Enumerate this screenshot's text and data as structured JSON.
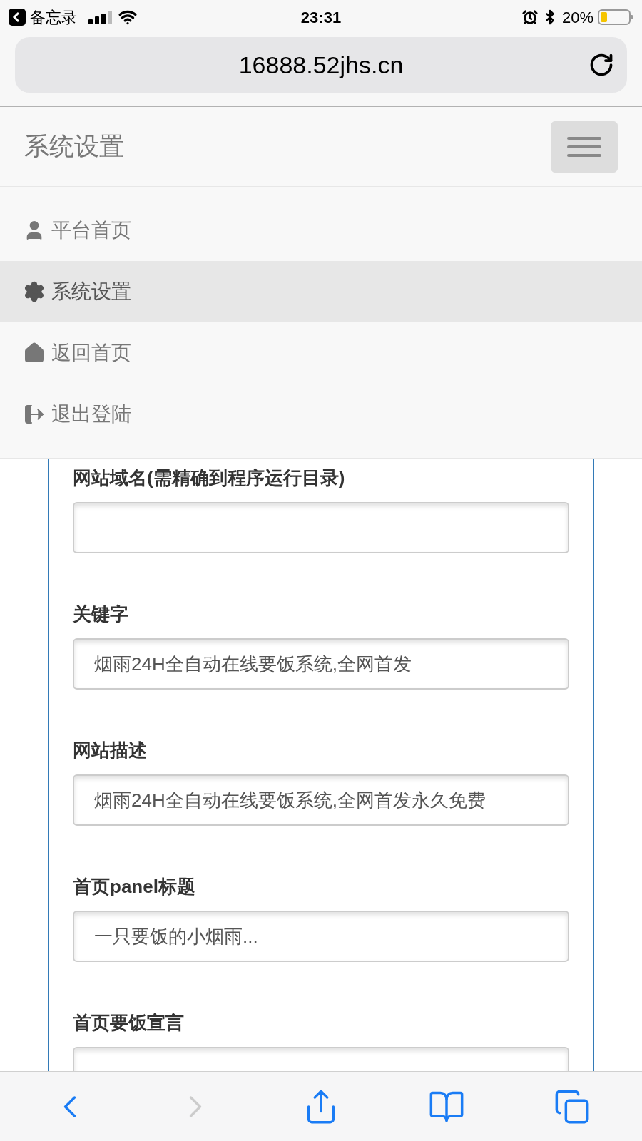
{
  "status_bar": {
    "back_app": "备忘录",
    "time": "23:31",
    "battery": "20%"
  },
  "address_bar": {
    "url": "16888.52jhs.cn"
  },
  "navbar": {
    "brand": "系统设置",
    "menu_expanded": true
  },
  "menu": [
    {
      "label": "平台首页",
      "selected": false
    },
    {
      "label": "系统设置",
      "selected": true
    },
    {
      "label": "返回首页",
      "selected": false
    },
    {
      "label": "退出登陆",
      "selected": false
    }
  ],
  "form": {
    "fields": [
      {
        "label": "网站域名(需精确到程序运行目录)"
      },
      {
        "label": "关键字",
        "value": "烟雨24H全自动在线要饭系统,全网首发"
      },
      {
        "label": "网站描述",
        "value": "烟雨24H全自动在线要饭系统,全网首发永久免费"
      },
      {
        "label": "首页panel标题",
        "value": "一只要饭的小烟雨..."
      },
      {
        "label": "首页要饭宣言"
      }
    ]
  },
  "toolbar": [
    {
      "disabled": false
    },
    {
      "disabled": true
    },
    {
      "disabled": false
    },
    {
      "disabled": false
    },
    {
      "disabled": false
    }
  ]
}
